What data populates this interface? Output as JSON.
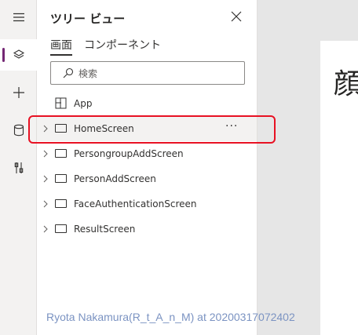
{
  "left_rail": {
    "items": [
      {
        "icon": "hamburger-menu-icon"
      },
      {
        "icon": "layers-icon",
        "active": true
      },
      {
        "icon": "plus-icon"
      },
      {
        "icon": "database-icon"
      },
      {
        "icon": "tools-icon"
      }
    ],
    "accent_color": "#742774"
  },
  "tree_view": {
    "title": "ツリー ビュー",
    "tabs": [
      {
        "label": "画面",
        "selected": true
      },
      {
        "label": "コンポーネント",
        "selected": false
      }
    ],
    "search": {
      "placeholder": "検索"
    },
    "items": [
      {
        "label": "App",
        "icon": "app-grid-icon",
        "expandable": false
      },
      {
        "label": "HomeScreen",
        "icon": "screen-icon",
        "expandable": true,
        "selected": true,
        "more_label": "···"
      },
      {
        "label": "PersongroupAddScreen",
        "icon": "screen-icon",
        "expandable": true
      },
      {
        "label": "PersonAddScreen",
        "icon": "screen-icon",
        "expandable": true
      },
      {
        "label": "FaceAuthenticationScreen",
        "icon": "screen-icon",
        "expandable": true
      },
      {
        "label": "ResultScreen",
        "icon": "screen-icon",
        "expandable": true
      }
    ]
  },
  "canvas": {
    "visible_text": "顔"
  },
  "watermark": "Ryota Nakamura(R_t_A_n_M) at 20200317072402",
  "highlight_color": "#e81123"
}
